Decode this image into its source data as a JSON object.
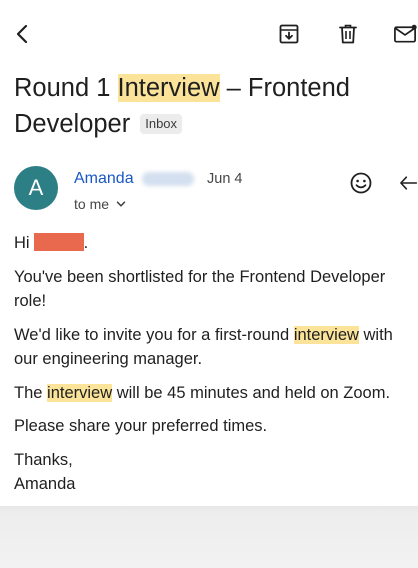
{
  "toolbar": {
    "back_icon": "arrow-left-icon",
    "archive_icon": "archive-icon",
    "delete_icon": "trash-icon",
    "mark_unread_icon": "mail-icon"
  },
  "email": {
    "subject_before": "Round 1 ",
    "subject_highlight": "Interview",
    "subject_after": " – Frontend Developer",
    "label_badge": "Inbox",
    "sender_initial": "A",
    "sender_name": "Amanda",
    "date": "Jun 4",
    "recipient": "to me",
    "greeting": "Hi",
    "greeting_end": ".",
    "para1": "You've been shortlisted for the Frontend Developer role!",
    "para2_before": "We'd like to invite you for a first-round ",
    "para2_highlight": "interview",
    "para2_after": " with our engineering manager.",
    "para3_before": "The ",
    "para3_highlight": "interview",
    "para3_after": " will be 45 minutes and held on Zoom.",
    "para4": "Please share your preferred times.",
    "signoff": "Thanks,",
    "signature": "Amanda"
  },
  "colors": {
    "highlight": "#fbe49a",
    "avatar": "#2d7f86",
    "sender": "#1a56c4",
    "redaction": "#e8694d"
  }
}
